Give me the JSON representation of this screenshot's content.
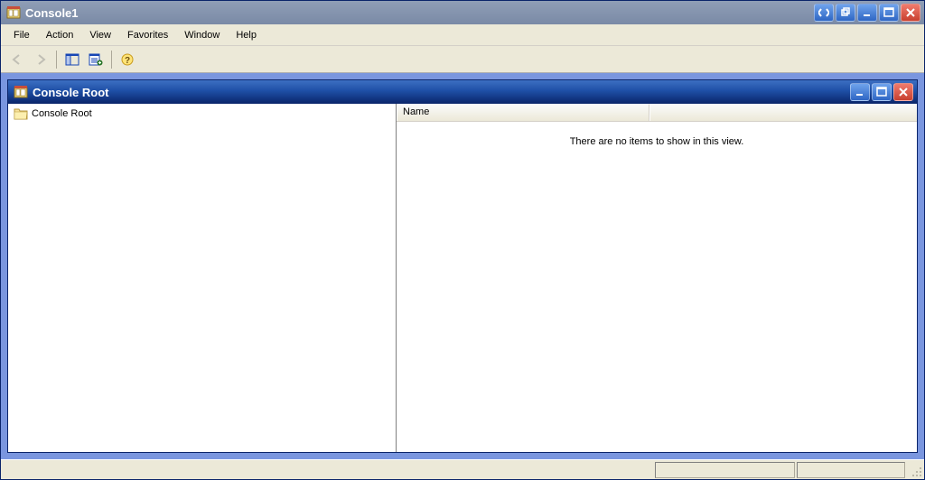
{
  "outer_window": {
    "title": "Console1"
  },
  "menu": {
    "file": "File",
    "action": "Action",
    "view": "View",
    "favorites": "Favorites",
    "window": "Window",
    "help": "Help"
  },
  "child_window": {
    "title": "Console Root"
  },
  "tree": {
    "root_label": "Console Root"
  },
  "list": {
    "name_header": "Name",
    "empty_message": "There are no items to show in this view."
  },
  "icons": {
    "mmc": "mmc-icon",
    "back": "back-icon",
    "forward": "forward-icon",
    "show_hide_tree": "show-hide-tree-icon",
    "properties": "properties-icon",
    "help": "help-icon"
  },
  "colors": {
    "mdi_bg": "#7A96DF",
    "accent": "#0A246A"
  }
}
